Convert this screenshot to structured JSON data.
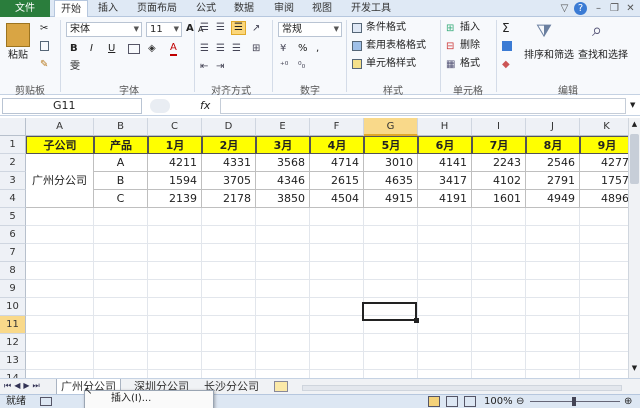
{
  "tabs": {
    "file": "文件",
    "items": [
      "开始",
      "插入",
      "页面布局",
      "公式",
      "数据",
      "审阅",
      "视图",
      "开发工具"
    ]
  },
  "ribbon": {
    "clipboard": {
      "paste": "粘贴",
      "label": "剪贴板"
    },
    "font": {
      "name": "宋体",
      "size": "11",
      "label": "字体",
      "bold": "B",
      "italic": "I",
      "underline": "U",
      "grow": "A",
      "shrink": "A",
      "fontcolor": "A",
      "phonetic": "雯"
    },
    "align": {
      "label": "对齐方式"
    },
    "number": {
      "format": "常规",
      "label": "数字",
      "percent": "%",
      "comma": ","
    },
    "styles": {
      "cond": "条件格式",
      "table": "套用表格格式",
      "cell": "单元格样式",
      "label": "样式"
    },
    "cells": {
      "insert": "插入",
      "delete": "删除",
      "format": "格式",
      "label": "单元格"
    },
    "editing": {
      "sigma": "Σ",
      "sort": "排序和筛选",
      "find": "查找和选择",
      "label": "编辑"
    }
  },
  "formula": {
    "namebox": "G11",
    "fx": "fx",
    "value": ""
  },
  "grid": {
    "columns": [
      "A",
      "B",
      "C",
      "D",
      "E",
      "F",
      "G",
      "H",
      "I",
      "J",
      "K"
    ],
    "rows": [
      "1",
      "2",
      "3",
      "4",
      "5",
      "6",
      "7",
      "8",
      "9",
      "10",
      "11",
      "12",
      "13",
      "14"
    ],
    "header": [
      "子公司",
      "产品",
      "1月",
      "2月",
      "3月",
      "4月",
      "5月",
      "6月",
      "7月",
      "8月",
      "9月"
    ],
    "company": "广州分公司",
    "data": [
      {
        "product": "A",
        "values": [
          "4211",
          "4331",
          "3568",
          "4714",
          "3010",
          "4141",
          "2243",
          "2546",
          "4277"
        ]
      },
      {
        "product": "B",
        "values": [
          "1594",
          "3705",
          "4346",
          "2615",
          "4635",
          "3417",
          "4102",
          "2791",
          "1757"
        ]
      },
      {
        "product": "C",
        "values": [
          "2139",
          "2178",
          "3850",
          "4504",
          "4915",
          "4191",
          "1601",
          "4949",
          "4896"
        ]
      }
    ],
    "selected": "G11"
  },
  "sheets": [
    "广州分公司",
    "深圳分公司",
    "长沙分公司"
  ],
  "status": {
    "ready": "就绪",
    "zoom": "100%"
  },
  "context_menu": {
    "insert": "插入(I)..."
  }
}
